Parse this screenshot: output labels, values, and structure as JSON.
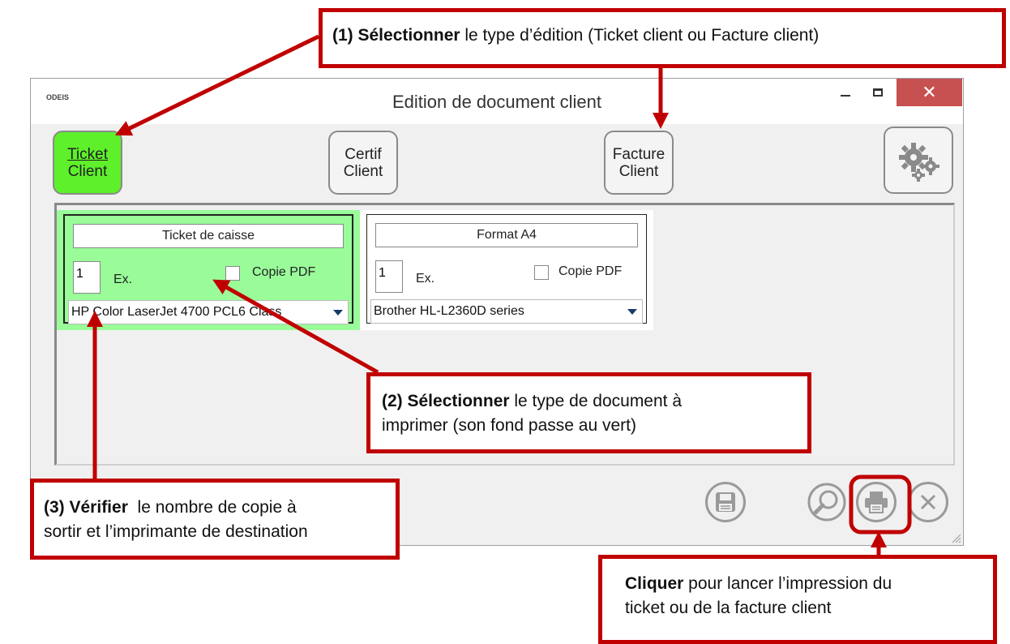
{
  "window": {
    "logo_text": "ODEIS",
    "title": "Edition de document client",
    "close_symbol": "✕"
  },
  "toolbar": {
    "ticket": {
      "line1": "Ticket",
      "line2": "Client",
      "active": true
    },
    "certif": {
      "line1": "Certif",
      "line2": "Client"
    },
    "facture": {
      "line1": "Facture",
      "line2": "Client"
    },
    "settings_icon": "gears-icon"
  },
  "documents": [
    {
      "title": "Ticket de caisse",
      "copies": "1",
      "ex_label": "Ex.",
      "pdf_label": "Copie PDF",
      "pdf_checked": false,
      "printer": "HP Color LaserJet 4700 PCL6 Class",
      "selected": true
    },
    {
      "title": "Format A4",
      "copies": "1",
      "ex_label": "Ex.",
      "pdf_label": "Copie PDF",
      "pdf_checked": false,
      "printer": "Brother HL-L2360D series",
      "selected": false
    }
  ],
  "bottom_icons": [
    "save-icon",
    "zoom-icon",
    "print-icon",
    "cancel-icon"
  ],
  "annotations": {
    "a1": {
      "bold": "(1) Sélectionner",
      "rest": " le type d’édition (Ticket client ou Facture client)"
    },
    "a2": {
      "bold": "(2) Sélectionner",
      "rest": " le type de document à",
      "line2": "imprimer (son fond passe au vert)"
    },
    "a3": {
      "bold": "(3) Vérifier",
      "rest": "  le nombre de copie à",
      "line2": "sortir et l’imprimante de destination"
    },
    "a4": {
      "bold": "Cliquer",
      "rest": " pour lancer l’impression du",
      "line2": "ticket ou de la facture client"
    }
  },
  "colors": {
    "active_button": "#5ef02a",
    "selected_card": "#99fc99",
    "annotation": "#c00000",
    "close_button": "#c75050"
  }
}
